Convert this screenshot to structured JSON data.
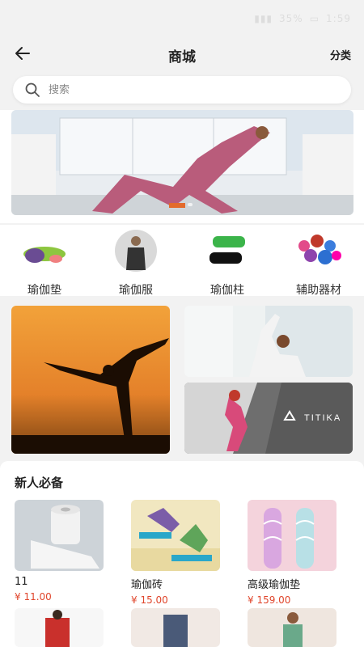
{
  "status_bar": {
    "battery": "35%",
    "time": "1:59"
  },
  "header": {
    "title": "商城",
    "category_label": "分类"
  },
  "search": {
    "placeholder": "搜索"
  },
  "categories": [
    {
      "label": "瑜伽垫"
    },
    {
      "label": "瑜伽服"
    },
    {
      "label": "瑜伽柱"
    },
    {
      "label": "辅助器材"
    }
  ],
  "promo": {
    "brand_text": "TITIKA"
  },
  "section": {
    "title": "新人必备"
  },
  "products": [
    {
      "name": "11",
      "price": "¥ 11.00"
    },
    {
      "name": "瑜伽砖",
      "price": "¥ 15.00"
    },
    {
      "name": "高级瑜伽垫",
      "price": "¥ 159.00"
    }
  ],
  "colors": {
    "accent": "#e36b2c",
    "price": "#e0452b"
  }
}
